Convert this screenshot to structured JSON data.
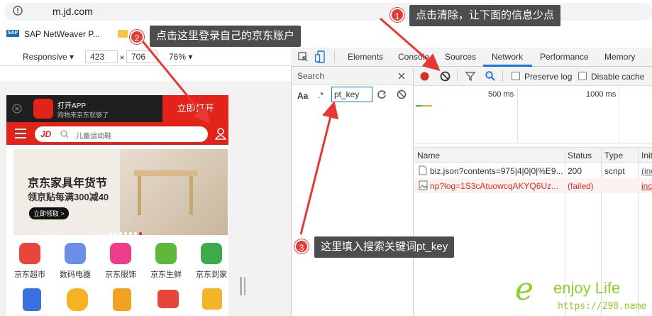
{
  "address": {
    "url": "m.jd.com"
  },
  "bookmarks": [
    {
      "label": "SAP NetWeaver P..."
    }
  ],
  "device_toolbar": {
    "mode": "Responsive",
    "width": "423",
    "times": "×",
    "height": "706",
    "zoom": "76%"
  },
  "devtools": {
    "tabs": [
      "Elements",
      "Console",
      "Sources",
      "Network",
      "Performance",
      "Memory"
    ],
    "active_tab": "Network",
    "search": {
      "title": "Search",
      "aa": "Aa",
      "regex": ".*",
      "query": "pt_key"
    },
    "network_toolbar": {
      "preserve_log": "Preserve log",
      "disable_cache": "Disable cache"
    },
    "timeline": {
      "marks": [
        "500 ms",
        "1000 ms"
      ]
    },
    "columns": [
      "Name",
      "Status",
      "Type",
      "Init"
    ],
    "rows": [
      {
        "name": "biz.json?contents=975|4|0|0|%E9...",
        "status": "200",
        "type": "script",
        "init": "(inc",
        "failed": false
      },
      {
        "name": "np?log=1S3cAtuowcqAKYQ6Uz...",
        "status": "(failed)",
        "type": "",
        "init": "inc",
        "failed": true
      }
    ]
  },
  "phone": {
    "app_open_title": "打开APP",
    "app_open_sub": "购物来京东就够了",
    "app_open_btn": "立即打开",
    "jd_logo": "JD",
    "search_placeholder": "儿童运动鞋",
    "banner": {
      "title": "京东家具年货节",
      "sub": "领京贴每满300减40",
      "cta": "立即领取 >"
    },
    "categories": [
      "京东超市",
      "数码电器",
      "京东服饰",
      "京东生鲜",
      "京东到家"
    ]
  },
  "annotations": [
    {
      "num": "1",
      "text": "点击清除，让下面的信息少点"
    },
    {
      "num": "2",
      "text": "点击这里登录自己的京东账户"
    },
    {
      "num": "3",
      "text": "这里填入搜索关键词pt_key"
    }
  ],
  "watermark": {
    "text": "enjoy Life",
    "url": "https://298.name"
  },
  "colors": {
    "accent": "#1a73e8",
    "jd_red": "#e2231a",
    "record_red": "#d93025",
    "arrow_red": "#e53935"
  }
}
